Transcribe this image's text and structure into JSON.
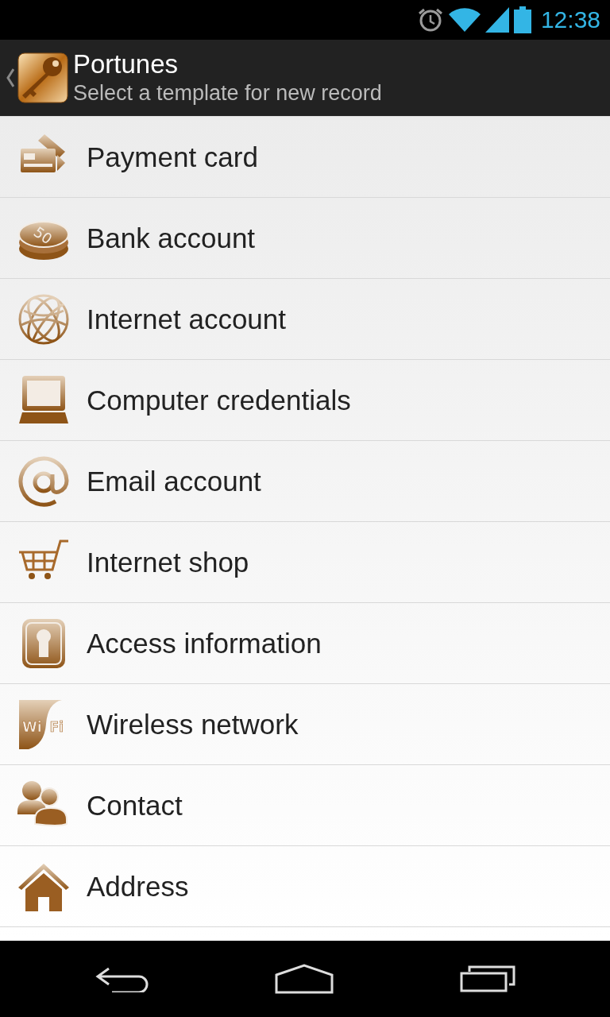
{
  "status_bar": {
    "time": "12:38"
  },
  "action_bar": {
    "title": "Portunes",
    "subtitle": "Select a template for new record"
  },
  "templates": [
    {
      "label": "Payment card",
      "kind": "card"
    },
    {
      "label": "Bank account",
      "kind": "coins",
      "icon_text": "50"
    },
    {
      "label": "Internet account",
      "kind": "globe"
    },
    {
      "label": "Computer credentials",
      "kind": "computer"
    },
    {
      "label": "Email account",
      "kind": "at"
    },
    {
      "label": "Internet shop",
      "kind": "cart"
    },
    {
      "label": "Access information",
      "kind": "keyhole"
    },
    {
      "label": "Wireless network",
      "kind": "wifi",
      "icon_text": "Wi Fi"
    },
    {
      "label": "Contact",
      "kind": "people"
    },
    {
      "label": "Address",
      "kind": "home"
    }
  ]
}
